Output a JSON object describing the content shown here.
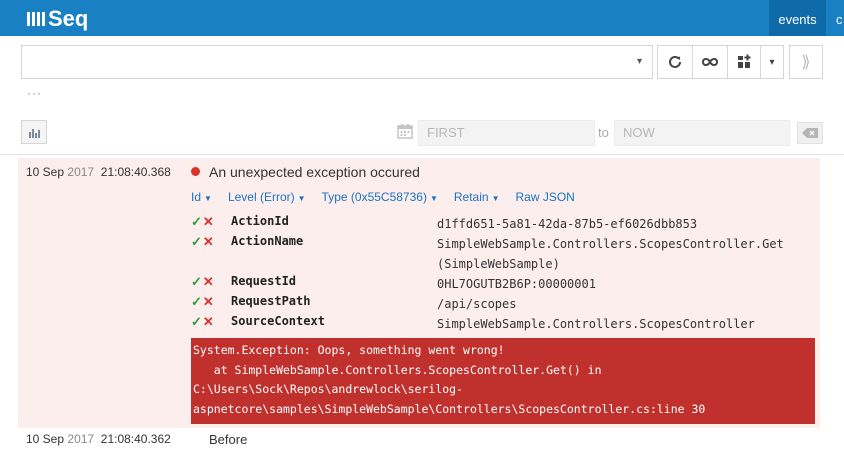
{
  "app": {
    "logo_text": "Seq",
    "nav_active": "events",
    "nav_next": "c"
  },
  "toolbar": {
    "search_value": "",
    "search_caret": "▾",
    "refresh_icon": "refresh-icon",
    "tail_icon": "infinity-icon",
    "signals_icon": "signal-add-icon",
    "dropdown_caret": "▾",
    "collapse_icon": "⟫",
    "ellipsis": "···"
  },
  "range": {
    "from_placeholder": "FIRST",
    "to_label": "to",
    "to_placeholder": "NOW"
  },
  "events": [
    {
      "date": "10 Sep",
      "year": "2017",
      "time": "21:08:40.368",
      "level_color": "#d9322d",
      "message": "An unexpected exception occured",
      "chips": [
        {
          "label": "Id"
        },
        {
          "label": "Level (Error)"
        },
        {
          "label": "Type (0x55C58736)"
        },
        {
          "label": "Retain"
        },
        {
          "label": "Raw JSON"
        }
      ],
      "properties": [
        {
          "name": "ActionId",
          "value": "d1ffd651-5a81-42da-87b5-ef6026dbb853"
        },
        {
          "name": "ActionName",
          "value": "SimpleWebSample.Controllers.ScopesController.Get",
          "value2": "(SimpleWebSample)"
        },
        {
          "name": "RequestId",
          "value": "0HL7OGUTB2B6P:00000001"
        },
        {
          "name": "RequestPath",
          "value": "/api/scopes"
        },
        {
          "name": "SourceContext",
          "value": "SimpleWebSample.Controllers.ScopesController"
        }
      ],
      "exception_lines": [
        "System.Exception: Oops, something went wrong!",
        "   at SimpleWebSample.Controllers.ScopesController.Get() in",
        "C:\\Users\\Sock\\Repos\\andrewlock\\serilog-",
        "aspnetcore\\samples\\SimpleWebSample\\Controllers\\ScopesController.cs:line 30"
      ]
    },
    {
      "date": "10 Sep",
      "year": "2017",
      "time": "21:08:40.362",
      "message": "Before"
    }
  ],
  "colors": {
    "topbar": "#1a80c4",
    "nav_active": "#0e6aa8",
    "error_bg": "#fdeeee",
    "exception_bg": "#c0312e",
    "link": "#1a72c2",
    "include": "#2e9b3a",
    "exclude": "#d9322d"
  }
}
